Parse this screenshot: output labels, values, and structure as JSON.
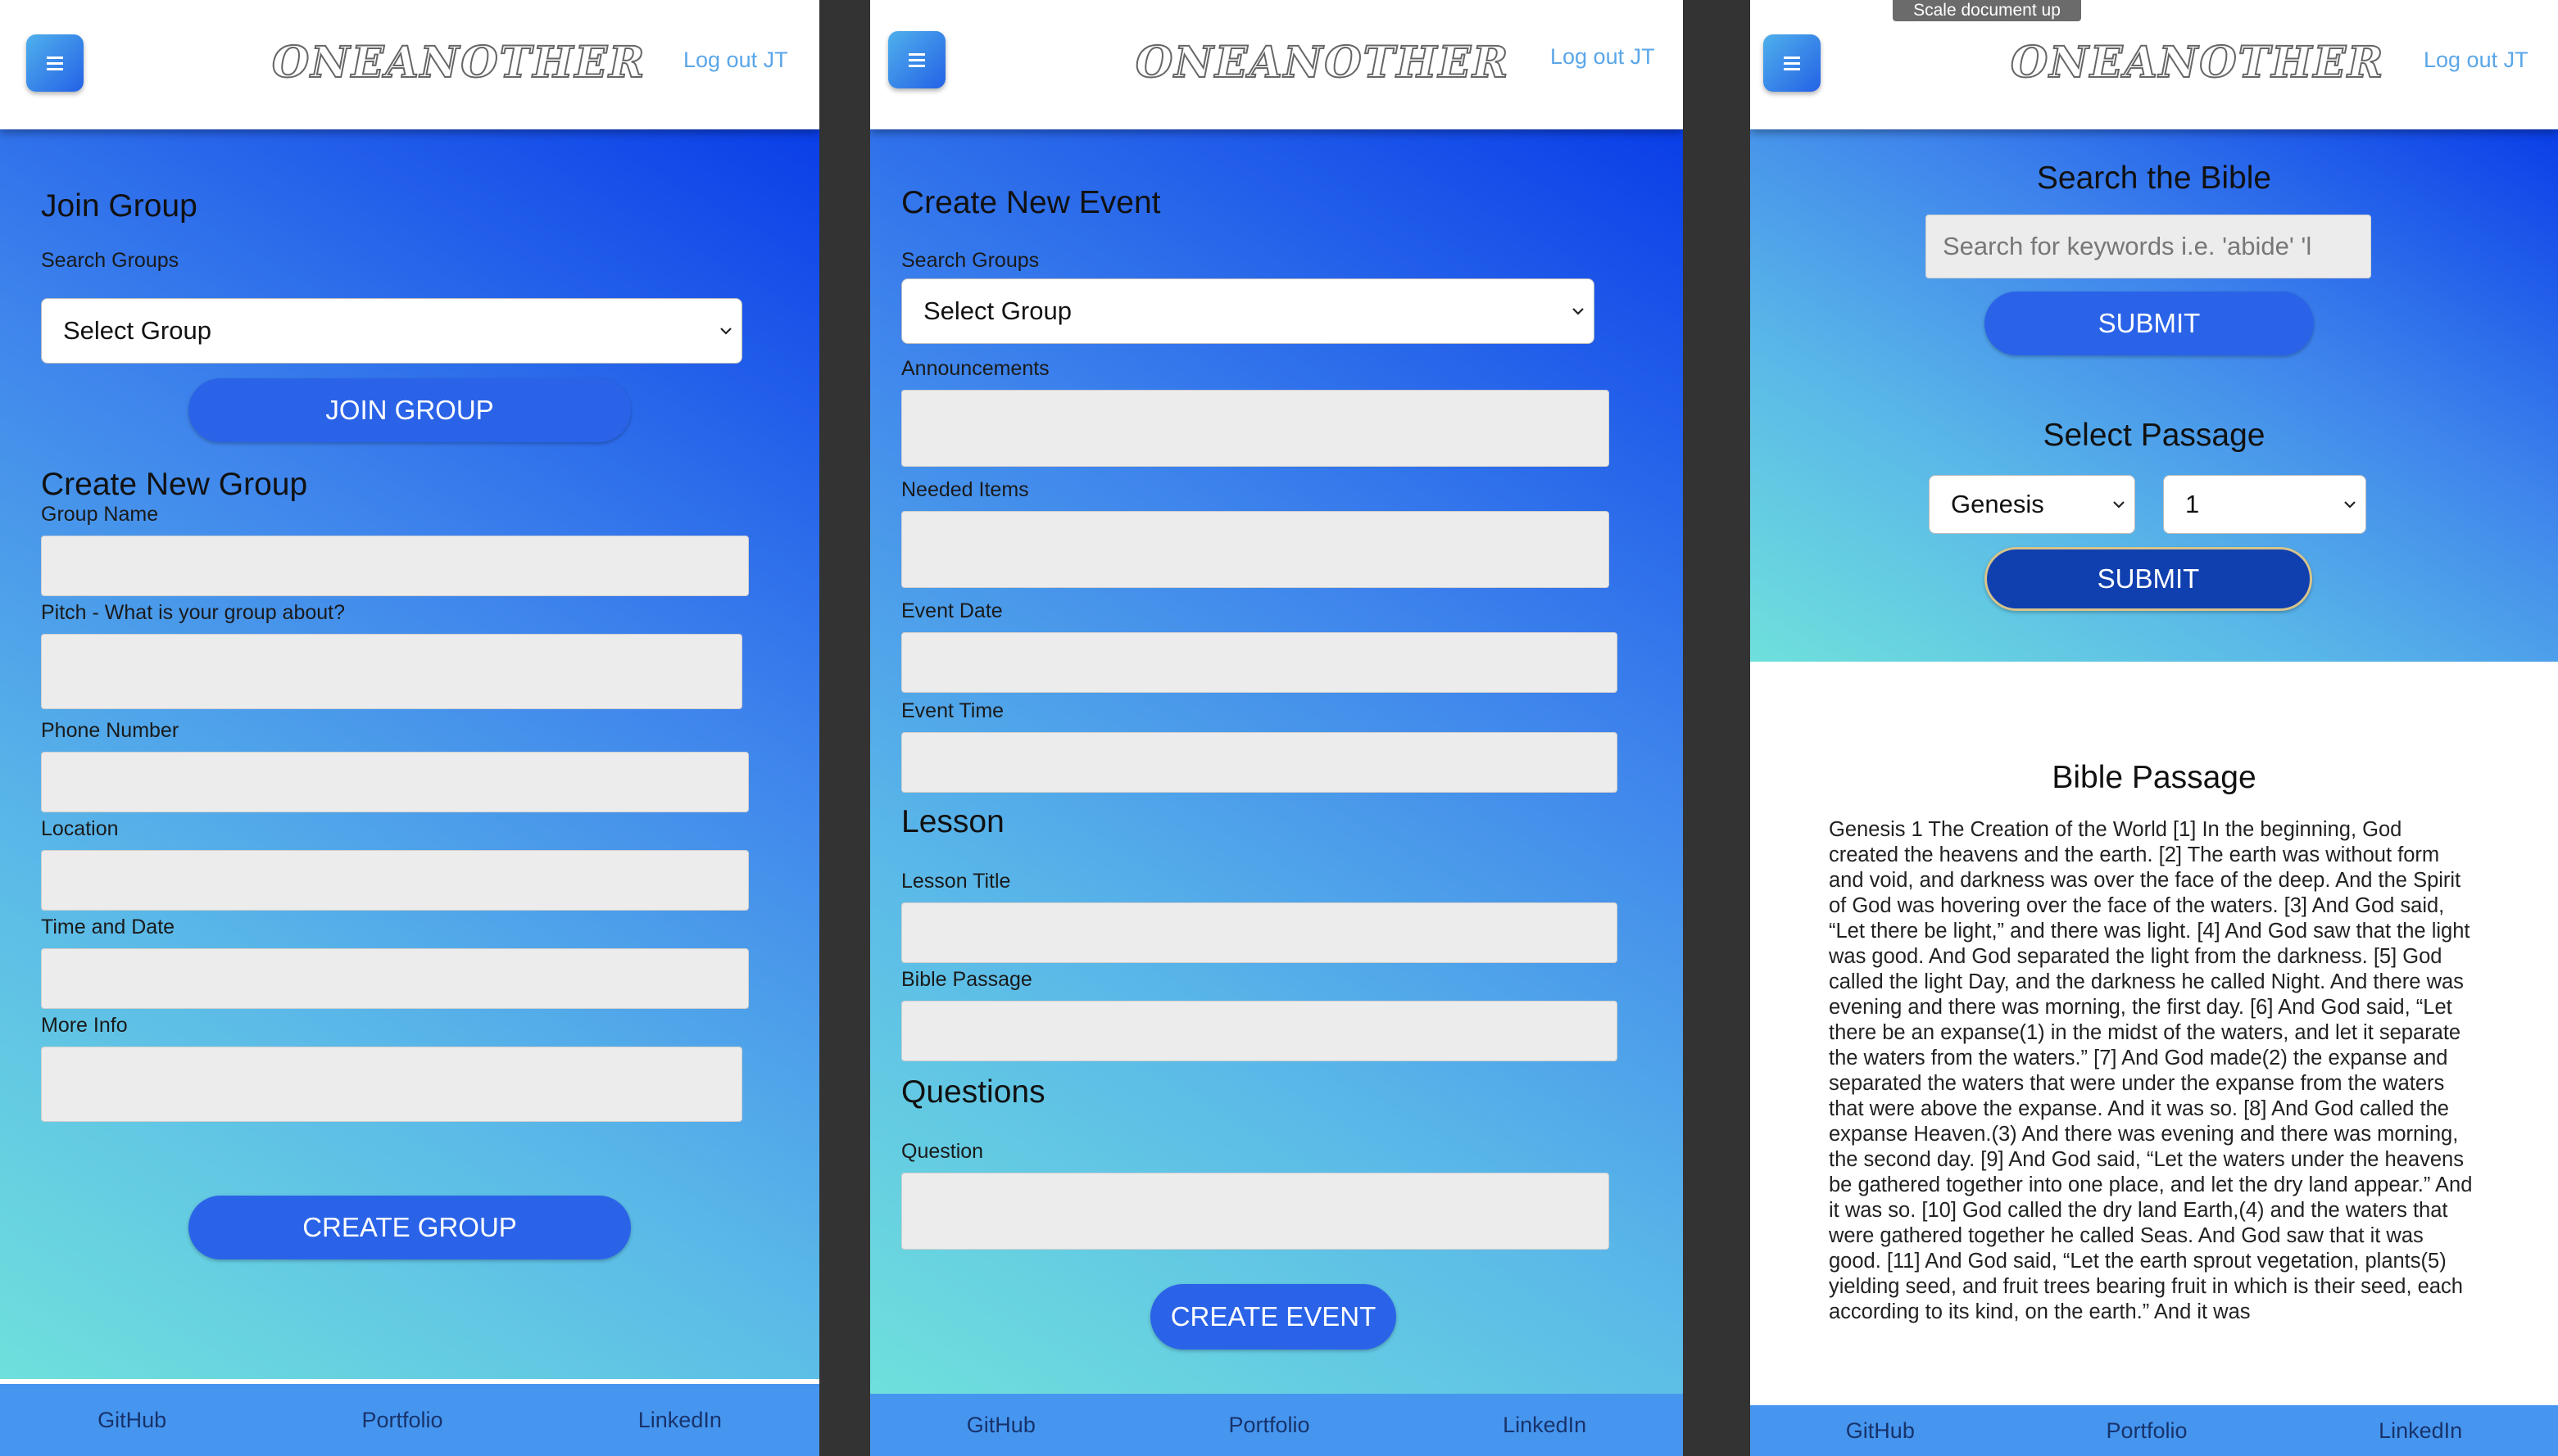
{
  "app": {
    "logo": "ONEANOTHER",
    "logout": "Log out JT",
    "footer": {
      "github": "GitHub",
      "portfolio": "Portfolio",
      "linkedin": "LinkedIn"
    }
  },
  "tooltip": "Scale document up",
  "join_group_screen": {
    "title": "Join Group",
    "search_label": "Search Groups",
    "select_value": "Select Group",
    "join_button": "JOIN GROUP",
    "create_title": "Create New Group",
    "fields": {
      "group_name": "Group Name",
      "pitch": "Pitch - What is your group about?",
      "phone": "Phone Number",
      "location": "Location",
      "time_date": "Time and Date",
      "more_info": "More Info"
    },
    "create_button": "CREATE GROUP"
  },
  "create_event_screen": {
    "title": "Create New Event",
    "search_label": "Search Groups",
    "select_value": "Select Group",
    "fields": {
      "announcements": "Announcements",
      "needed_items": "Needed Items",
      "event_date": "Event Date",
      "event_time": "Event Time",
      "lesson_title": "Lesson Title",
      "bible_passage": "Bible Passage",
      "question": "Question"
    },
    "lesson_heading": "Lesson",
    "questions_heading": "Questions",
    "create_button": "CREATE EVENT"
  },
  "bible_screen": {
    "search_title": "Search the Bible",
    "search_placeholder": "Search for keywords i.e. 'abide'  'l",
    "submit": "SUBMIT",
    "select_title": "Select Passage",
    "book": "Genesis",
    "chapter": "1",
    "submit2": "SUBMIT",
    "passage_title": "Bible Passage",
    "passage_text": "Genesis 1 The Creation of the World [1] In the beginning, God created the heavens and the earth. [2] The earth was without form and void, and darkness was over the face of the deep. And the Spirit of God was hovering over the face of the waters. [3] And God said, “Let there be light,” and there was light. [4] And God saw that the light was good. And God separated the light from the darkness. [5] God called the light Day, and the darkness he called Night. And there was evening and there was morning, the first day. [6] And God said, “Let there be an expanse(1) in the midst of the waters, and let it separate the waters from the waters.” [7] And God made(2) the expanse and separated the waters that were under the expanse from the waters that were above the expanse. And it was so. [8] And God called the expanse Heaven.(3) And there was evening and there was morning, the second day. [9] And God said, “Let the waters under the heavens be gathered together into one place, and let the dry land appear.” And it was so. [10] God called the dry land Earth,(4) and the waters that were gathered together he called Seas. And God saw that it was good. [11] And God said, “Let the earth sprout vegetation, plants(5) yielding seed, and fruit trees bearing fruit in which is their seed, each according to its kind, on the earth.” And it was"
  },
  "colors": {
    "accent_blue": "#2a63e8",
    "footer_blue": "#4696f0",
    "gradient_top": "#0a3ee8",
    "gradient_bottom": "#6fe0dc",
    "link_blue": "#5aa6e8"
  }
}
